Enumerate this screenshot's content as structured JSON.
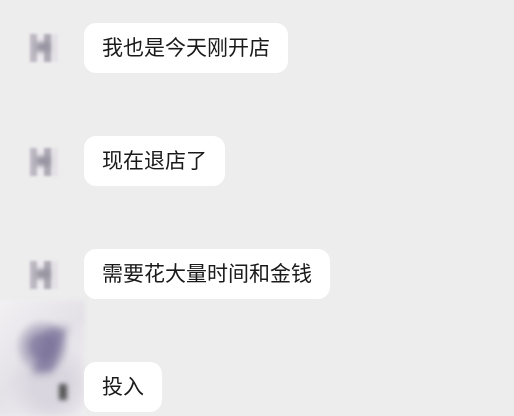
{
  "chat": {
    "messages": [
      {
        "sender": "",
        "text": "我也是今天刚开店"
      },
      {
        "sender": "",
        "text": "现在退店了"
      },
      {
        "sender": "",
        "text": "需要花大量时间和金钱"
      },
      {
        "sender": "",
        "text": "投入"
      }
    ]
  },
  "colors": {
    "background": "#ededed",
    "bubble": "#ffffff",
    "text": "#1a1a1a"
  }
}
